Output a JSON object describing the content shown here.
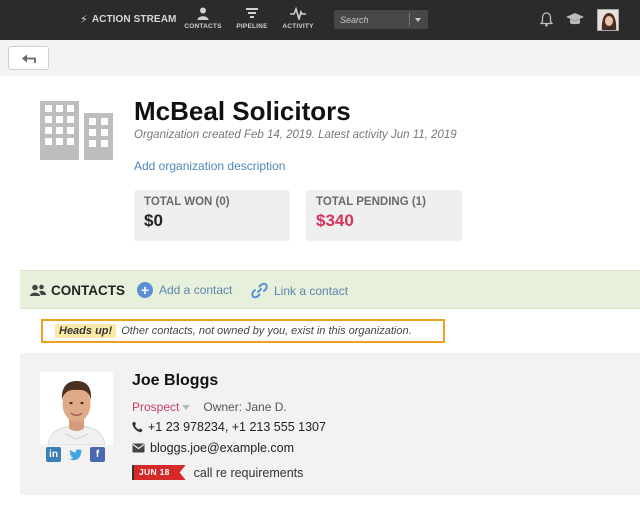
{
  "topnav": {
    "brand": "ACTION STREAM",
    "items": [
      {
        "label": "CONTACTS"
      },
      {
        "label": "PIPELINE"
      },
      {
        "label": "ACTIVITY"
      }
    ],
    "search_placeholder": "Search",
    "colors": {
      "bar": "#2b2b2b",
      "search": "#474747"
    }
  },
  "organization": {
    "name": "McBeal Solicitors",
    "meta": "Organization created Feb 14, 2019. Latest activity Jun 11, 2019",
    "add_description": "Add organization description",
    "stats": [
      {
        "label": "TOTAL WON (0)",
        "value": "$0"
      },
      {
        "label": "TOTAL PENDING (1)",
        "value": "$340",
        "color": "#d4335a"
      }
    ]
  },
  "contacts_section": {
    "title": "CONTACTS",
    "add_label": "Add a contact",
    "link_label": "Link a contact",
    "background": "#e6f0da"
  },
  "notice": {
    "badge": "Heads up!",
    "text": "Other contacts, not owned by you, exist in this organization.",
    "border_color": "#f0a020"
  },
  "contact": {
    "name": "Joe Bloggs",
    "stage": "Prospect",
    "owner": "Owner: Jane D.",
    "phones": "+1 23 978234, +1 213 555 1307",
    "email": "bloggs.joe@example.com",
    "task_date": "JUN 18",
    "task_text": "call re requirements",
    "social": [
      "linkedin-icon",
      "twitter-icon",
      "facebook-icon"
    ]
  }
}
